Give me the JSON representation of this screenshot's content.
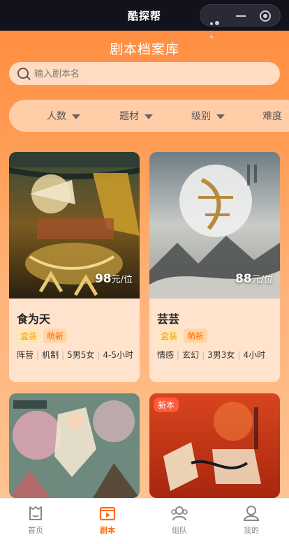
{
  "app": {
    "title": "酷探帮"
  },
  "page": {
    "title": "剧本档案库"
  },
  "search": {
    "placeholder": "输入剧本名"
  },
  "filters": [
    "人数",
    "题材",
    "级别",
    "难度"
  ],
  "cards": [
    {
      "name": "食为天",
      "price": "98",
      "unit": "元/位",
      "tags": [
        "盒装",
        "萌新"
      ],
      "meta": [
        "阵营",
        "机制",
        "5男5女",
        "4-5小时"
      ]
    },
    {
      "name": "芸芸",
      "price": "88",
      "unit": "元/位",
      "tags": [
        "盒装",
        "萌新"
      ],
      "meta": [
        "情感",
        "玄幻",
        "3男3女",
        "4小时"
      ]
    },
    {
      "badge": ""
    },
    {
      "badge": "新本"
    }
  ],
  "tabs": [
    {
      "label": "首页",
      "icon": "home-icon"
    },
    {
      "label": "剧本",
      "icon": "script-icon"
    },
    {
      "label": "组队",
      "icon": "team-icon"
    },
    {
      "label": "我的",
      "icon": "user-icon"
    }
  ],
  "colors": {
    "accent": "#ff6a10",
    "tag_text": "#ff6a00",
    "topbar": "#12121c"
  }
}
